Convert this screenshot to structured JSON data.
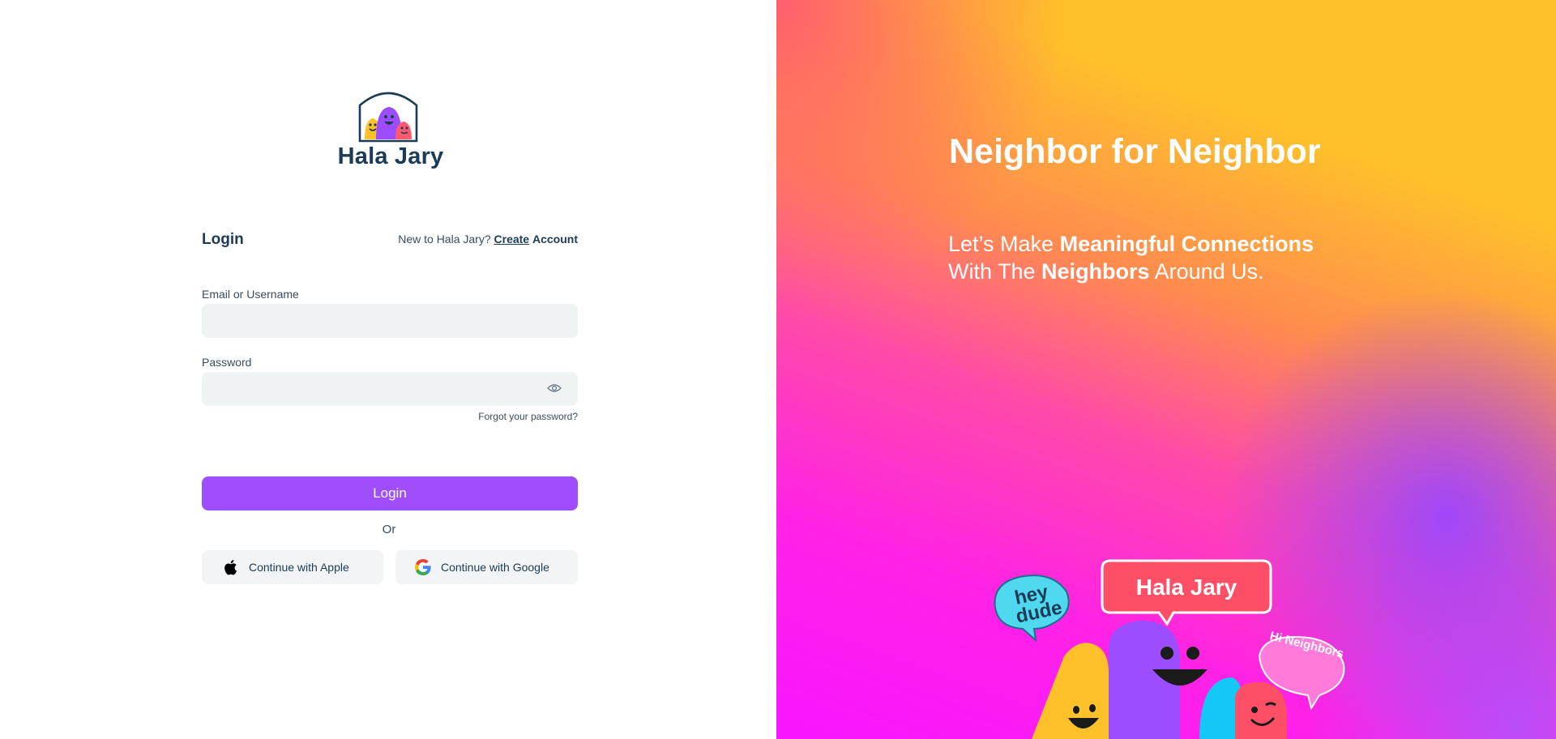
{
  "app": {
    "name": "Hala Jary"
  },
  "logo": {
    "text": "Hala Jary"
  },
  "login_form": {
    "title": "Login",
    "signup_prompt": "New to Hala Jary?",
    "signup_link_create": "Create",
    "signup_link_account": "Account",
    "email_label": "Email or Username",
    "email_value": "",
    "password_label": "Password",
    "password_value": "",
    "forgot_password": "Forgot your password?",
    "submit_label": "Login",
    "divider": "Or",
    "apple_label": "Continue with Apple",
    "google_label": "Continue with Google"
  },
  "hero": {
    "headline": "Neighbor for Neighbor",
    "tagline_line1_prefix": "Let’s Make ",
    "tagline_line1_bold": "Meaningful Connections",
    "tagline_line2_prefix": "With The ",
    "tagline_line2_bold": "Neighbors",
    "tagline_line2_suffix": " Around Us.",
    "bubble_brand": "Hala Jary",
    "bubble_hey": "hey",
    "bubble_dude": "dude",
    "bubble_hi": "Hi Neighbors"
  },
  "colors": {
    "brand_dark": "#1b3b57",
    "primary_button": "#a04dfd",
    "input_bg": "#f0f3f4",
    "gradient_yellow": "#ffc12a",
    "gradient_magenta": "#f716ff",
    "bubble_red": "#ff4f66",
    "bubble_cyan": "#4fd8f0",
    "bubble_pink": "#ff7ad9"
  },
  "icons": [
    "logo-icon",
    "eye-icon",
    "apple-icon",
    "google-icon"
  ]
}
